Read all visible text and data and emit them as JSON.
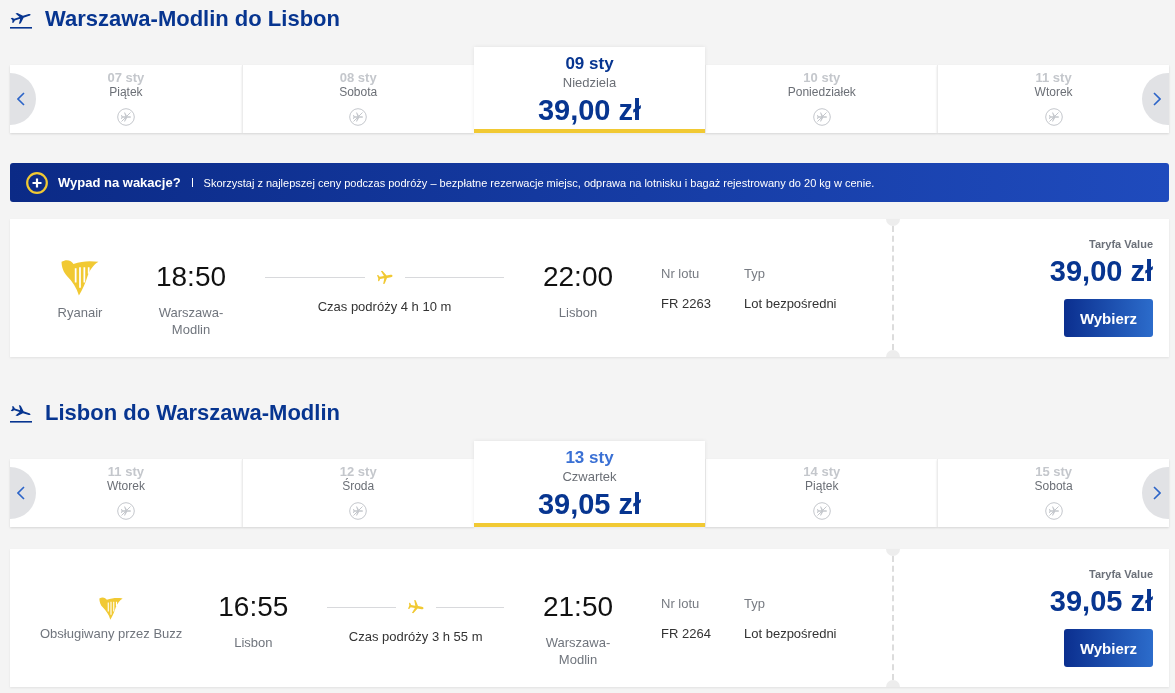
{
  "sections": [
    {
      "kind": "departure",
      "title": "Warszawa-Modlin do Lisbon",
      "dates": [
        {
          "date": "07 sty",
          "weekday": "Piątek",
          "selected": false,
          "hovered": false
        },
        {
          "date": "08 sty",
          "weekday": "Sobota",
          "selected": false,
          "hovered": false
        },
        {
          "date": "09 sty",
          "weekday": "Niedziela",
          "price": "39,00 zł",
          "selected": true,
          "hovered": false
        },
        {
          "date": "10 sty",
          "weekday": "Poniedziałek",
          "selected": false,
          "hovered": false
        },
        {
          "date": "11 sty",
          "weekday": "Wtorek",
          "selected": false,
          "hovered": false
        }
      ],
      "banner": {
        "title": "Wypad na wakacje?",
        "text": "Skorzystaj z najlepszej ceny podczas podróży – bezpłatne rezerwacje miejsc, odprawa na lotnisku i bagaż rejestrowany do 20 kg w cenie."
      },
      "flights": [
        {
          "airline": {
            "kind": "main",
            "name": "Ryanair"
          },
          "departure_time": "18:50",
          "departure_airport": "Warszawa-Modlin",
          "duration": "Czas podróży 4 h 10 m",
          "arrival_time": "22:00",
          "arrival_airport": "Lisbon",
          "flight_number_label": "Nr lotu",
          "flight_number": "FR 2263",
          "type_label": "Typ",
          "type": "Lot bezpośredni",
          "fare_label": "Taryfa Value",
          "price": "39,00 zł",
          "button": "Wybierz"
        }
      ]
    },
    {
      "kind": "arrival",
      "title": "Lisbon do Warszawa-Modlin",
      "dates": [
        {
          "date": "11 sty",
          "weekday": "Wtorek",
          "selected": false,
          "hovered": false
        },
        {
          "date": "12 sty",
          "weekday": "Środa",
          "selected": false,
          "hovered": false
        },
        {
          "date": "13 sty",
          "weekday": "Czwartek",
          "price": "39,05 zł",
          "selected": true,
          "hovered": true
        },
        {
          "date": "14 sty",
          "weekday": "Piątek",
          "selected": false,
          "hovered": false
        },
        {
          "date": "15 sty",
          "weekday": "Sobota",
          "selected": false,
          "hovered": false
        }
      ],
      "flights": [
        {
          "airline": {
            "kind": "operated",
            "name": "Obsługiwany przez Buzz"
          },
          "departure_time": "16:55",
          "departure_airport": "Lisbon",
          "duration": "Czas podróży 3 h 55 m",
          "arrival_time": "21:50",
          "arrival_airport": "Warszawa-Modlin",
          "flight_number_label": "Nr lotu",
          "flight_number": "FR 2264",
          "type_label": "Typ",
          "type": "Lot bezpośredni",
          "fare_label": "Taryfa Value",
          "price": "39,05 zł",
          "button": "Wybierz"
        }
      ]
    }
  ]
}
